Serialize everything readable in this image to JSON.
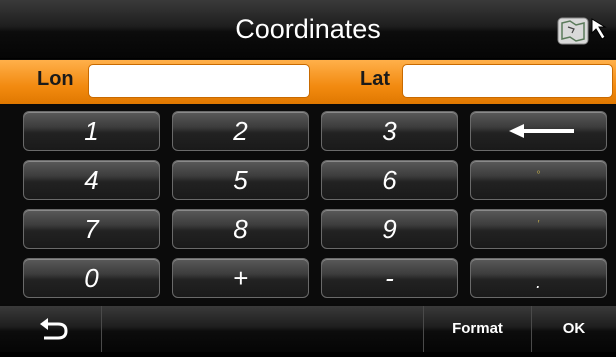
{
  "header": {
    "title": "Coordinates",
    "map_button_icon": "map-cursor-icon"
  },
  "coords": {
    "lon_label": "Lon",
    "lat_label": "Lat",
    "lon_value": "",
    "lat_value": ""
  },
  "keypad": {
    "k1": "1",
    "k2": "2",
    "k3": "3",
    "backspace_icon": "left-arrow-icon",
    "k4": "4",
    "k5": "5",
    "k6": "6",
    "degree": "°",
    "k7": "7",
    "k8": "8",
    "k9": "9",
    "minute": "′",
    "k0": "0",
    "plus": "+",
    "minus": "-",
    "dot": "."
  },
  "footer": {
    "back_icon": "back-arrow-icon",
    "format_label": "Format",
    "ok_label": "OK"
  },
  "colors": {
    "accent": "#f28a10",
    "key_fill": "#2a2a2a",
    "text": "#ffffff"
  }
}
